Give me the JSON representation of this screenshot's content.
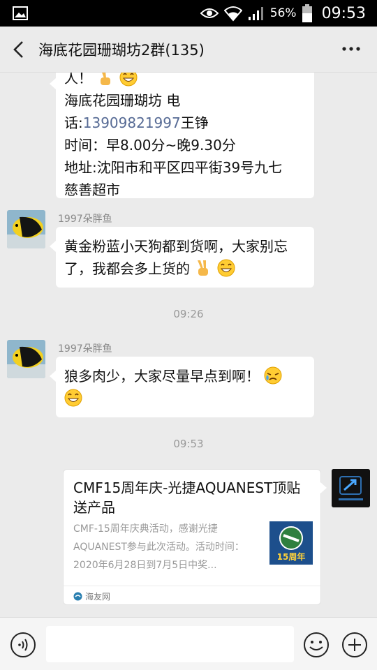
{
  "status_bar": {
    "battery_percent": "56%",
    "time": "09:53"
  },
  "header": {
    "title": "海底花园珊瑚坊2群(135)"
  },
  "messages": [
    {
      "lines": [
        "人！",
        "海底花园珊瑚坊   电",
        "话:",
        "13909821997",
        "王铮",
        "时间：早8.00分~晚9.30分",
        "地址:沈阳市和平区四平街39号九七",
        "慈善超市"
      ]
    },
    {
      "sender": "1997朵胖鱼",
      "lines": [
        "黄金粉蓝小天狗都到货啊，大家别忘",
        "了，我都会多上货的"
      ]
    },
    {
      "sender": "1997朵胖鱼",
      "lines": [
        "狼多肉少，大家尽量早点到啊！"
      ]
    }
  ],
  "timestamps": [
    "09:26",
    "09:53"
  ],
  "link_card": {
    "title": "CMF15周年庆-光捷AQUANEST顶贴送产品",
    "description": "CMF-15周年庆典活动，感谢光捷AQUANEST参与此次活动。活动时间：2020年6月28日到7月5日中奖...",
    "thumb_text": "15周年",
    "source": "海友网"
  },
  "colors": {
    "background": "#ebebeb",
    "bubble": "#ffffff",
    "link": "#576b95",
    "muted": "#999999"
  }
}
